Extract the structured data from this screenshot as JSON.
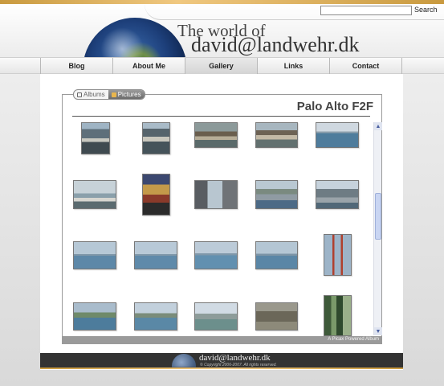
{
  "search": {
    "placeholder": "",
    "button_label": "Search"
  },
  "header": {
    "title_line1": "The world of",
    "title_line2": "david@landwehr.dk"
  },
  "nav": {
    "items": [
      {
        "label": "Blog"
      },
      {
        "label": "About Me"
      },
      {
        "label": "Gallery",
        "active": true
      },
      {
        "label": "Links"
      },
      {
        "label": "Contact"
      }
    ]
  },
  "gallery": {
    "tabs": [
      {
        "label": "Albums",
        "active": false
      },
      {
        "label": "Pictures",
        "active": true
      }
    ],
    "album_title": "Palo Alto F2F",
    "footer_text": "A Picax Powered Album",
    "thumbnails": [
      "boats-dock",
      "boats-dock",
      "sea-lions-dock",
      "sea-lions-pier",
      "bay-water",
      "pier-railing",
      "carousel",
      "city-street",
      "marina-hills",
      "harbor-boats",
      "bay-water",
      "bay-water",
      "bay-water",
      "bay-water",
      "golden-gate-bridge",
      "shoreline",
      "coastal-town",
      "bay-hills",
      "rocky-cliff",
      "forest-trees"
    ]
  },
  "footer": {
    "name": "david@landwehr.dk",
    "copyright": "© Copyright 2006-2007. All rights reserved."
  },
  "colors": {
    "accent": "#c99a3f",
    "footer_bg": "#333333",
    "active_tab": "#6c6c6c"
  }
}
